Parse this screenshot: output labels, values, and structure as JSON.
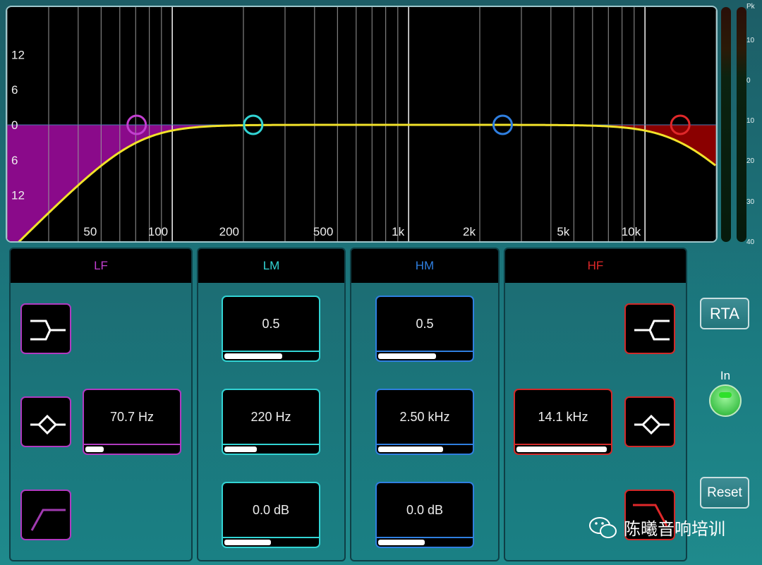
{
  "graph": {
    "freq_range": [
      20,
      20000
    ],
    "gain_range": [
      -20,
      20
    ],
    "y_labels": [
      {
        "v": 12,
        "t": "12"
      },
      {
        "v": 6,
        "t": "6"
      },
      {
        "v": 0,
        "t": "0"
      },
      {
        "v": -6,
        "t": "6"
      },
      {
        "v": -12,
        "t": "12"
      }
    ],
    "x_labels": [
      {
        "f": 50,
        "t": "50"
      },
      {
        "f": 100,
        "t": "100"
      },
      {
        "f": 200,
        "t": "200"
      },
      {
        "f": 500,
        "t": "500"
      },
      {
        "f": 1000,
        "t": "1k"
      },
      {
        "f": 2000,
        "t": "2k"
      },
      {
        "f": 5000,
        "t": "5k"
      },
      {
        "f": 10000,
        "t": "10k"
      }
    ],
    "curve_color": "#f2e22a"
  },
  "meter": {
    "labels": [
      "Pk",
      "10",
      "0",
      "10",
      "20",
      "30",
      "40"
    ]
  },
  "bands": [
    {
      "id": "lf",
      "title": "LF",
      "color": "#c23fd0",
      "freq_hz": 70.7,
      "gain_db": 0,
      "freq": "70.7 Hz",
      "freq_level": 0.2,
      "fill": "#8a0a8a"
    },
    {
      "id": "lm",
      "title": "LM",
      "color": "#32d4d4",
      "freq_hz": 220,
      "gain_db": 0,
      "q": "0.5",
      "q_level": 0.62,
      "freq": "220 Hz",
      "freq_level": 0.35,
      "gain": "0.0 dB",
      "gain_level": 0.5
    },
    {
      "id": "hm",
      "title": "HM",
      "color": "#2f7fe0",
      "freq_hz": 2500,
      "gain_db": 0,
      "q": "0.5",
      "q_level": 0.62,
      "freq": "2.50 kHz",
      "freq_level": 0.7,
      "gain": "0.0 dB",
      "gain_level": 0.5
    },
    {
      "id": "hf",
      "title": "HF",
      "color": "#e0282a",
      "freq_hz": 14100,
      "gain_db": 0,
      "freq": "14.1 kHz",
      "freq_level": 0.97,
      "fill": "#8a0000"
    }
  ],
  "controls": {
    "rta": "RTA",
    "in": "In",
    "reset": "Reset"
  },
  "watermark": "陈曦音响培训"
}
